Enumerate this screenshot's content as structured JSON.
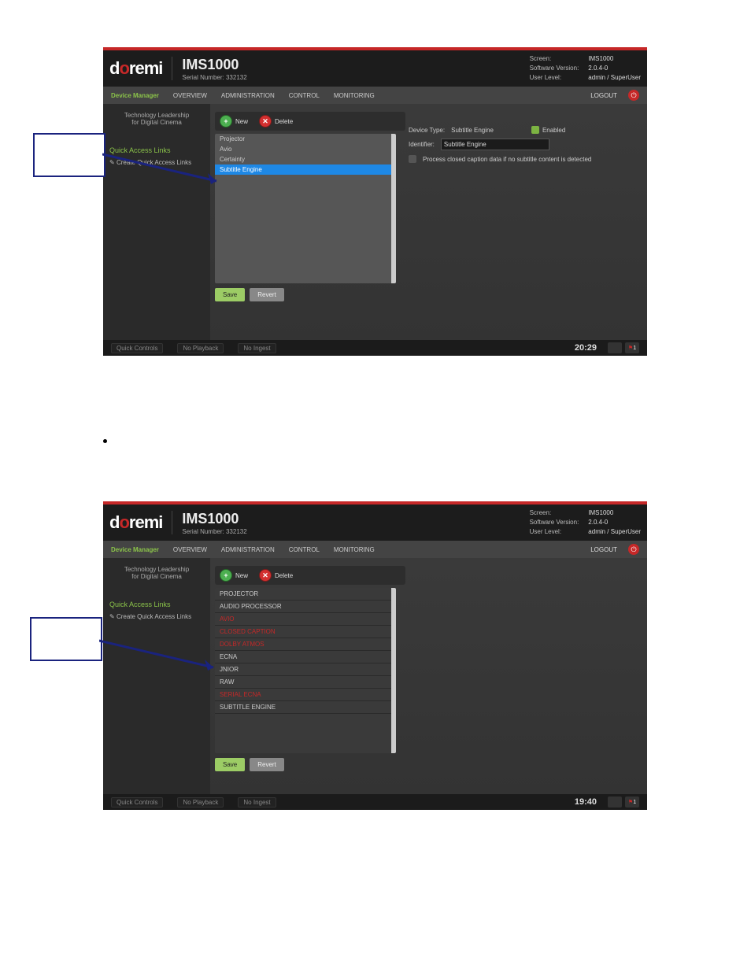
{
  "logo": {
    "d": "d",
    "o": "o",
    "rest": "remi"
  },
  "product": "IMS1000",
  "serial_label": "Serial Number: 332132",
  "hdr": {
    "screen_k": "Screen:",
    "screen_v": "IMS1000",
    "sw_k": "Software Version:",
    "sw_v": "2.0.4-0",
    "lvl_k": "User Level:",
    "lvl_v": "admin / SuperUser"
  },
  "nav": {
    "dm": "Device Manager",
    "ov": "OVERVIEW",
    "ad": "ADMINISTRATION",
    "ct": "CONTROL",
    "mn": "MONITORING",
    "logout": "LOGOUT"
  },
  "sidebar": {
    "tag1": "Technology Leadership",
    "tag2": "for Digital Cinema",
    "qal": "Quick Access Links",
    "qal_link": "Create Quick Access Links"
  },
  "btns": {
    "new": "New",
    "delete": "Delete",
    "save": "Save",
    "revert": "Revert"
  },
  "fig1_list": [
    "Projector",
    "Avio",
    "Certainty",
    "Subtitle Engine"
  ],
  "fig1_details": {
    "dt_k": "Device Type:",
    "dt_v": "Subtitle Engine",
    "en": "Enabled",
    "id_k": "Identifier:",
    "id_v": "Subtitle Engine",
    "cc": "Process closed caption data if no subtitle content is detected"
  },
  "fig2_list": [
    {
      "t": "PROJECTOR",
      "r": false
    },
    {
      "t": "AUDIO PROCESSOR",
      "r": false
    },
    {
      "t": "AVIO",
      "r": true
    },
    {
      "t": "CLOSED CAPTION",
      "r": true
    },
    {
      "t": "DOLBY ATMOS",
      "r": true
    },
    {
      "t": "ECNA",
      "r": false
    },
    {
      "t": "JNIOR",
      "r": false
    },
    {
      "t": "RAW",
      "r": false
    },
    {
      "t": "SERIAL ECNA",
      "r": true
    },
    {
      "t": "SUBTITLE ENGINE",
      "r": false
    }
  ],
  "footer": {
    "qc": "Quick Controls",
    "np": "No Playback",
    "ni": "No Ingest",
    "t1": "20:29",
    "t2": "19:40"
  }
}
